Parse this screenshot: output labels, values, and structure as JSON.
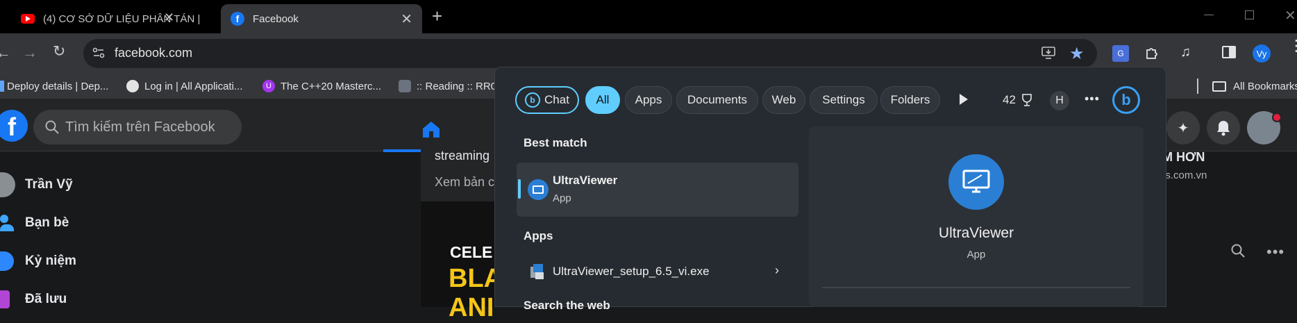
{
  "browser": {
    "tabs": [
      {
        "title": "(4) CƠ SỞ DỮ LIỆU PHÂN TÁN |",
        "icon": "youtube-icon"
      },
      {
        "title": "Facebook",
        "icon": "facebook-icon"
      }
    ],
    "url": "facebook.com",
    "profile_initials": "Vy",
    "bookmarks": [
      {
        "label": "Deploy details | Dep...",
        "icon": "bookmark-favicon"
      },
      {
        "label": "Log in | All Applicati...",
        "icon": "globe-icon"
      },
      {
        "label": "The C++20 Masterc...",
        "icon": "udemy-icon"
      },
      {
        "label": ":: Reading :: RR09",
        "icon": "reader-icon"
      }
    ],
    "all_bookmarks_label": "All Bookmarks"
  },
  "facebook": {
    "search_placeholder": "Tìm kiếm trên Facebook",
    "sidebar": [
      {
        "label": "Trần Vỹ",
        "icon": "profile-avatar"
      },
      {
        "label": "Bạn bè",
        "icon": "friends-icon"
      },
      {
        "label": "Kỷ niệm",
        "icon": "memories-icon"
      },
      {
        "label": "Đã lưu",
        "icon": "saved-icon"
      }
    ],
    "feed": {
      "text1": "streaming",
      "text2": "Xem bản c",
      "banner_line1": "CELE",
      "banner_line2": "BLA",
      "banner_line3": "ANI"
    },
    "right": {
      "ad_title": "ỆM HƠN",
      "ad_url": "es.com.vn"
    }
  },
  "search_panel": {
    "chips": {
      "chat": "Chat",
      "all": "All",
      "apps": "Apps",
      "documents": "Documents",
      "web": "Web",
      "settings": "Settings",
      "folders": "Folders"
    },
    "points": "42",
    "user_initial": "H",
    "best_match_header": "Best match",
    "best_match": {
      "name": "UltraViewer",
      "type": "App"
    },
    "apps_header": "Apps",
    "apps": [
      {
        "name": "UltraViewer_setup_6.5_vi.exe"
      }
    ],
    "search_web_header": "Search the web",
    "detail": {
      "name": "UltraViewer",
      "type": "App"
    }
  },
  "colors": {
    "accent": "#60cdff",
    "fb_blue": "#1877f2",
    "bing_blue": "#1a73e8"
  }
}
